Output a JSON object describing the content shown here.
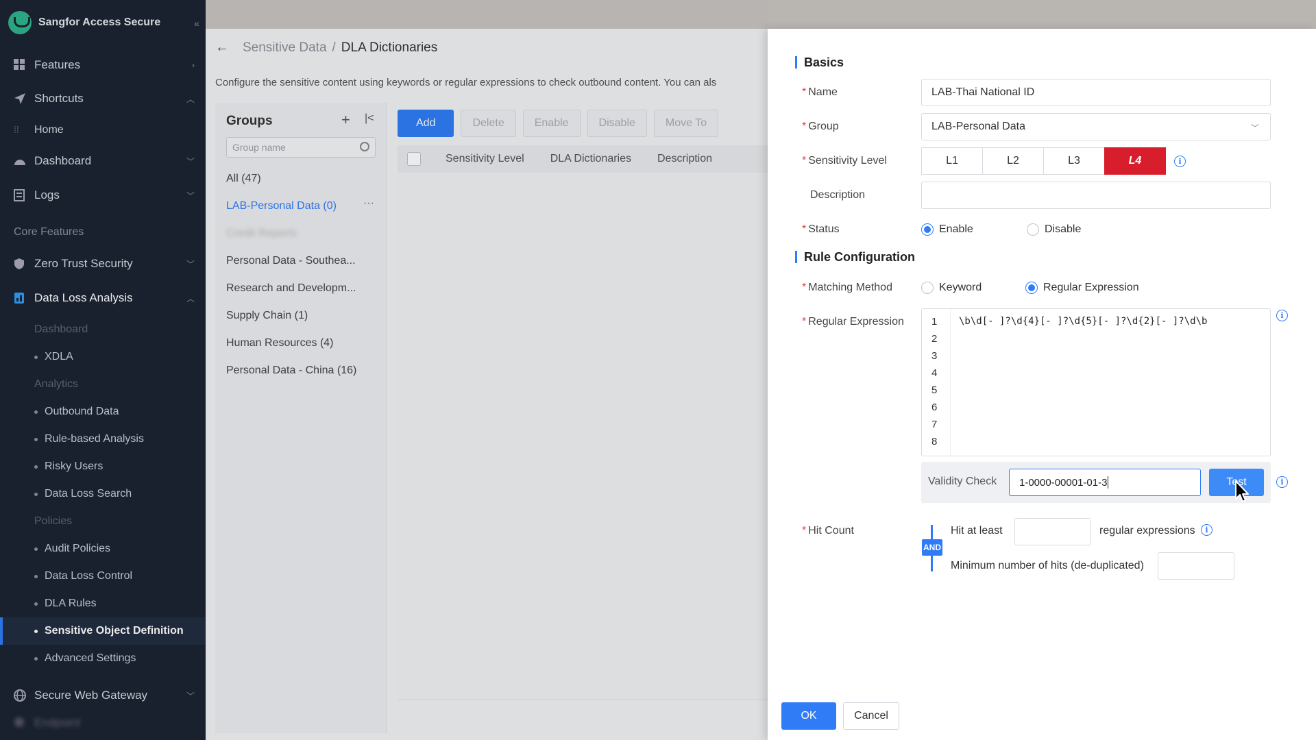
{
  "app": {
    "title": "Sangfor Access Secure"
  },
  "sidebar": {
    "features": "Features",
    "shortcuts": "Shortcuts",
    "home": "Home",
    "dashboard": "Dashboard",
    "logs": "Logs",
    "core_features": "Core Features",
    "zero_trust": "Zero Trust Security",
    "dla": "Data Loss Analysis",
    "dla_dashboard": "Dashboard",
    "xdla": "XDLA",
    "analytics": "Analytics",
    "outbound": "Outbound Data",
    "rule_based": "Rule-based Analysis",
    "risky_users": "Risky Users",
    "dls": "Data Loss Search",
    "policies": "Policies",
    "audit": "Audit Policies",
    "dlc": "Data Loss Control",
    "dla_rules": "DLA Rules",
    "sod": "Sensitive Object Definition",
    "advanced": "Advanced Settings",
    "swg": "Secure Web Gateway",
    "blurred": "Endpoint"
  },
  "main": {
    "breadcrumb_parent": "Sensitive Data",
    "breadcrumb_sep": "/",
    "breadcrumb_current": "DLA Dictionaries",
    "description": "Configure the sensitive content using keywords or regular expressions to check outbound content. You can als",
    "groups": {
      "title": "Groups",
      "search_placeholder": "Group name",
      "items": [
        "All (47)",
        "LAB-Personal Data (0)",
        "Credit Reports",
        "Personal Data - Southea...",
        "Research and Developm...",
        "Supply Chain (1)",
        "Human Resources (4)",
        "Personal Data - China (16)"
      ]
    },
    "toolbar": {
      "add": "Add",
      "delete": "Delete",
      "enable": "Enable",
      "disable": "Disable",
      "move_to": "Move To"
    },
    "table": {
      "col1": "Sensitivity Level",
      "col2": "DLA Dictionaries",
      "col3": "Description"
    }
  },
  "drawer": {
    "basics": "Basics",
    "name_label": "Name",
    "name_value": "LAB-Thai National ID",
    "group_label": "Group",
    "group_value": "LAB-Personal Data",
    "level_label": "Sensitivity Level",
    "levels": [
      "L1",
      "L2",
      "L3",
      "L4"
    ],
    "selected_level": "L4",
    "description_label": "Description",
    "description_value": "",
    "status_label": "Status",
    "status_enable": "Enable",
    "status_disable": "Disable",
    "status_selected": "Enable",
    "rule_config": "Rule Configuration",
    "matching_label": "Matching Method",
    "matching_keyword": "Keyword",
    "matching_regex": "Regular Expression",
    "matching_selected": "Regular Expression",
    "regex_label": "Regular Expression",
    "regex_line_numbers": [
      "1",
      "2",
      "3",
      "4",
      "5",
      "6",
      "7",
      "8"
    ],
    "regex_value": "\\b\\d[- ]?\\d{4}[- ]?\\d{5}[- ]?\\d{2}[- ]?\\d\\b",
    "validity_label": "Validity Check",
    "validity_value": "1-0000-00001-01-3",
    "test_button": "Test",
    "hit_count_label": "Hit Count",
    "hit_at_least": "Hit at least",
    "regular_expressions": "regular expressions",
    "and_label": "AND",
    "min_hits": "Minimum number of hits (de-duplicated)",
    "ok": "OK",
    "cancel": "Cancel"
  },
  "colors": {
    "accent": "#2f7cf6",
    "level_active": "#d81e2c",
    "sidebar_bg": "#1c2433",
    "required": "#e23c3c"
  }
}
